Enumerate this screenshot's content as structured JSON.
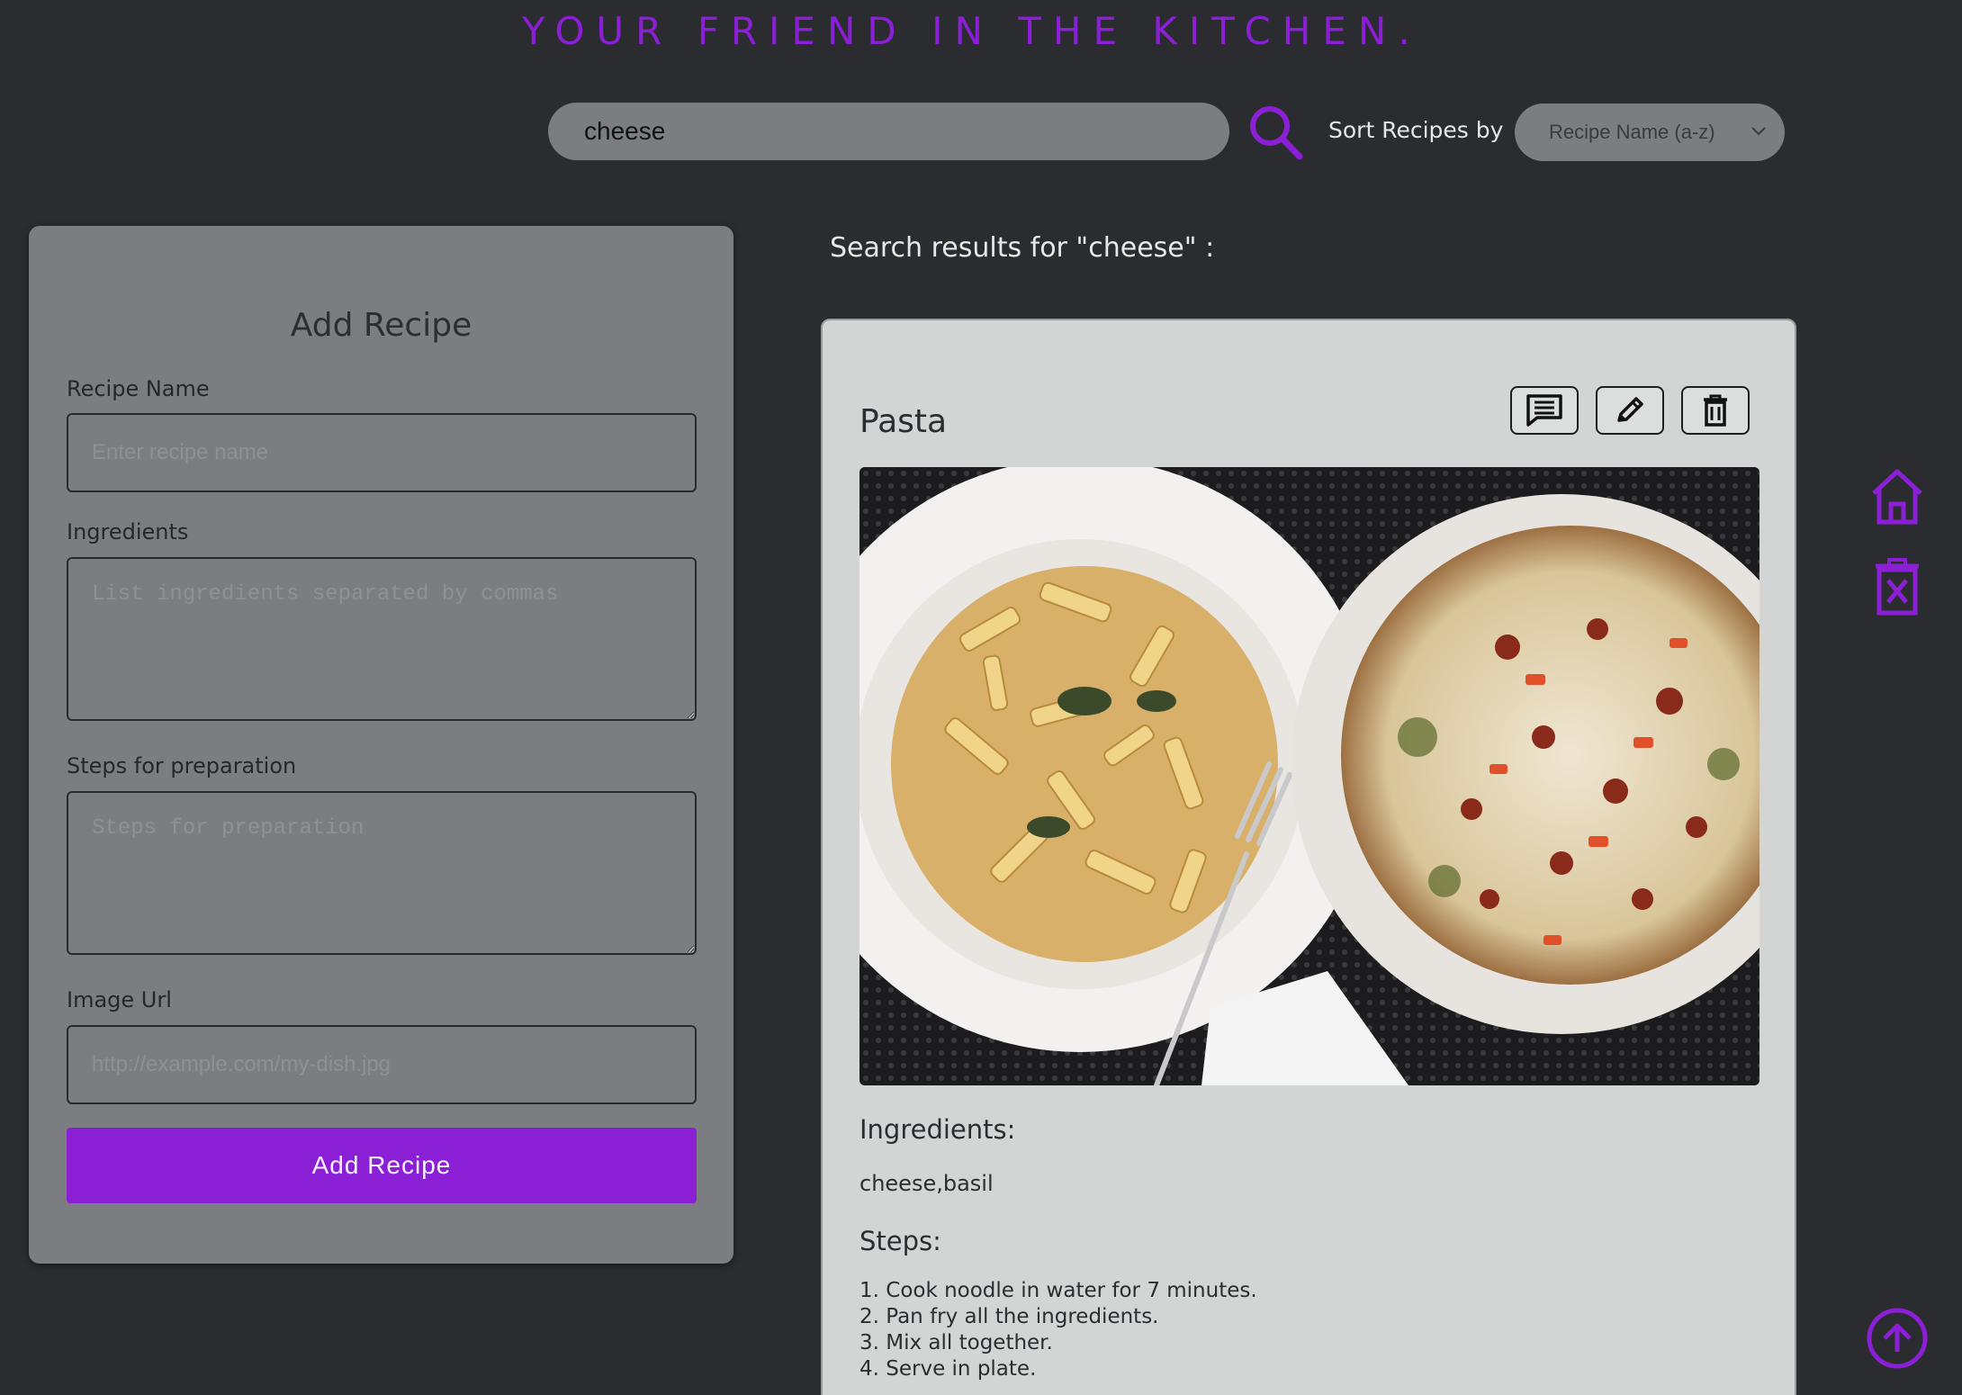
{
  "header": {
    "tagline": "YOUR FRIEND IN THE KITCHEN."
  },
  "search": {
    "value": "cheese",
    "sort_label": "Sort Recipes by",
    "sort_selected": "Recipe Name (a-z)"
  },
  "add_recipe": {
    "title": "Add Recipe",
    "name_label": "Recipe Name",
    "name_placeholder": "Enter recipe name",
    "ingredients_label": "Ingredients",
    "ingredients_placeholder": "List ingredients separated by commas",
    "steps_label": "Steps for preparation",
    "steps_placeholder": "Steps for preparation",
    "image_label": "Image Url",
    "image_placeholder": "http://example.com/my-dish.jpg",
    "submit_label": "Add Recipe"
  },
  "results": {
    "heading": "Search results for \"cheese\" :",
    "cards": [
      {
        "title": "Pasta",
        "ingredients_heading": "Ingredients:",
        "ingredients": "cheese,basil",
        "steps_heading": "Steps:",
        "steps": [
          "1. Cook noodle in water for 7 minutes.",
          "2. Pan fry all the ingredients.",
          "3. Mix all together.",
          "4. Serve in plate."
        ]
      }
    ]
  },
  "icons": {
    "search": "search-icon",
    "comment": "comment-icon",
    "edit": "pencil-icon",
    "delete": "trash-icon",
    "home": "home-icon",
    "clear": "trash-x-icon",
    "scroll_top": "arrow-up-circle-icon"
  },
  "colors": {
    "background": "#2b2c2f",
    "accent": "#8a1fd6",
    "panel": "#7c7d80",
    "card": "#d3d4d4"
  }
}
